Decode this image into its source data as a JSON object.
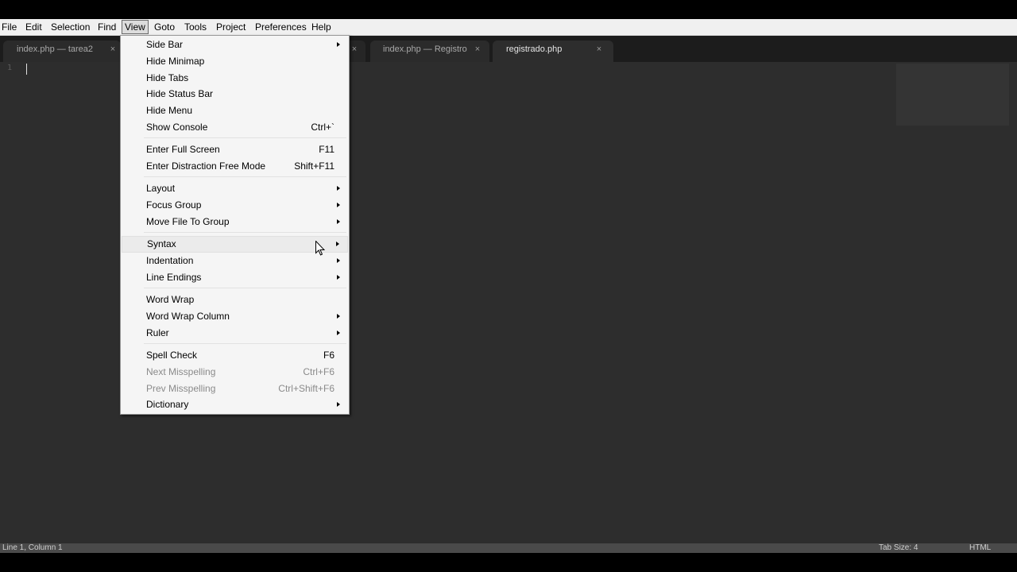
{
  "menubar": {
    "items": [
      {
        "label": "File"
      },
      {
        "label": "Edit"
      },
      {
        "label": "Selection"
      },
      {
        "label": "Find"
      },
      {
        "label": "View",
        "active": true
      },
      {
        "label": "Goto"
      },
      {
        "label": "Tools"
      },
      {
        "label": "Project"
      },
      {
        "label": "Preferences"
      },
      {
        "label": "Help"
      }
    ]
  },
  "tabs": [
    {
      "label": "index.php — tarea2",
      "close": "×"
    },
    {
      "label": "index.php — Registro",
      "close": "×"
    },
    {
      "label": "registrado.php",
      "close": "×",
      "selected": true
    }
  ],
  "hidden_tab_close": "×",
  "editor": {
    "line_number": "1"
  },
  "view_menu": {
    "items": [
      {
        "label": "Side Bar",
        "submenu": true
      },
      {
        "label": "Hide Minimap"
      },
      {
        "label": "Hide Tabs"
      },
      {
        "label": "Hide Status Bar"
      },
      {
        "label": "Hide Menu"
      },
      {
        "label": "Show Console",
        "shortcut": "Ctrl+`"
      },
      {
        "label": "Enter Full Screen",
        "shortcut": "F11"
      },
      {
        "label": "Enter Distraction Free Mode",
        "shortcut": "Shift+F11"
      },
      {
        "label": "Layout",
        "submenu": true
      },
      {
        "label": "Focus Group",
        "submenu": true
      },
      {
        "label": "Move File To Group",
        "submenu": true
      },
      {
        "label": "Syntax",
        "submenu": true,
        "highlighted": true
      },
      {
        "label": "Indentation",
        "submenu": true
      },
      {
        "label": "Line Endings",
        "submenu": true
      },
      {
        "label": "Word Wrap"
      },
      {
        "label": "Word Wrap Column",
        "submenu": true
      },
      {
        "label": "Ruler",
        "submenu": true
      },
      {
        "label": "Spell Check",
        "shortcut": "F6"
      },
      {
        "label": "Next Misspelling",
        "shortcut": "Ctrl+F6",
        "disabled": true
      },
      {
        "label": "Prev Misspelling",
        "shortcut": "Ctrl+Shift+F6",
        "disabled": true
      },
      {
        "label": "Dictionary",
        "submenu": true
      }
    ]
  },
  "statusbar": {
    "position": "Line 1, Column 1",
    "tab_size": "Tab Size: 4",
    "syntax": "HTML"
  },
  "colors": {
    "editor_bg": "#2d2d2d",
    "tabstrip_bg": "#1c1c1c",
    "menubar_bg": "#f0f0f0",
    "menu_bg": "#f5f5f5",
    "statusbar_bg": "#4a4a4a"
  }
}
